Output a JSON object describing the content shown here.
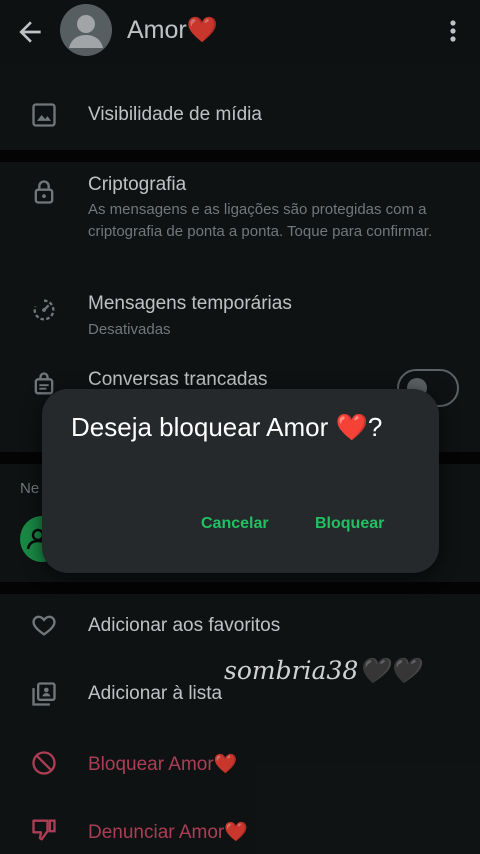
{
  "header": {
    "title": "Amor❤️"
  },
  "media_visibility": {
    "label": "Visibilidade de mídia"
  },
  "encryption": {
    "title": "Criptografia",
    "subtitle": "As mensagens e as ligações são protegidas com a criptografia de ponta a ponta. Toque para confirmar."
  },
  "disappearing": {
    "title": "Mensagens temporárias",
    "subtitle": "Desativadas"
  },
  "locked_chats": {
    "title": "Conversas trancadas",
    "toggle_on": false
  },
  "groups": {
    "label_fragment": "Ne"
  },
  "actions": {
    "favorites": "Adicionar aos favoritos",
    "add_list": "Adicionar à lista",
    "block": "Bloquear Amor❤️",
    "report": "Denunciar Amor❤️"
  },
  "dialog": {
    "title": "Deseja bloquear Amor ❤️?",
    "cancel": "Cancelar",
    "confirm": "Bloquear"
  },
  "watermark": "sombria38🖤🖤",
  "colors": {
    "accent_green": "#21c063",
    "danger_red": "#d34b68",
    "dialog_bg": "#25292b",
    "screen_bg": "#121718"
  }
}
